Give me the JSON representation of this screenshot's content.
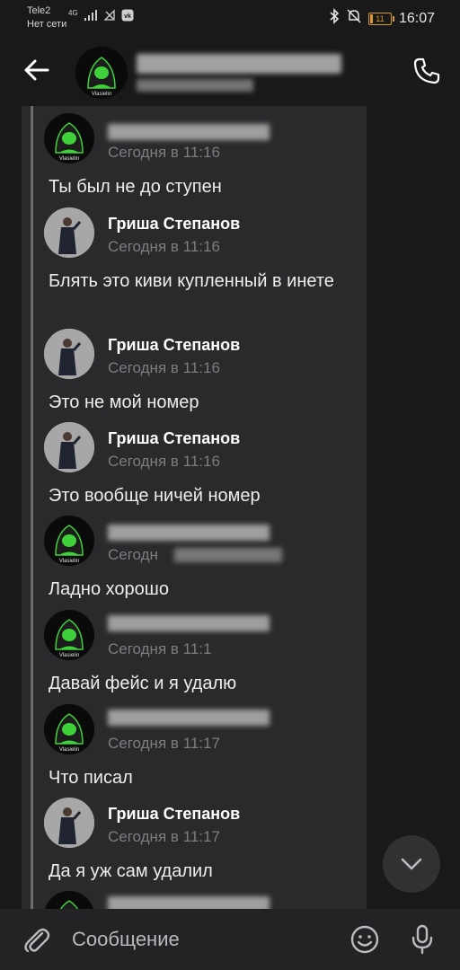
{
  "status_bar": {
    "carrier": "Tele2",
    "network": "Нет сети",
    "network_type": "4G",
    "battery": "11",
    "time": "16:07"
  },
  "header": {
    "back_icon": "arrow-left-icon",
    "call_icon": "phone-icon"
  },
  "messages": [
    {
      "author": "",
      "time": "Сегодня в 11:16",
      "text": "Ты был не до ступен",
      "avatar": "hacker"
    },
    {
      "author": "Гриша Степанов",
      "time": "Сегодня в 11:16",
      "text": "Блять это киви купленный в инете",
      "avatar": "person"
    },
    {
      "author": "Гриша Степанов",
      "time": "Сегодня в 11:16",
      "text": "Это не мой номер",
      "avatar": "person"
    },
    {
      "author": "Гриша Степанов",
      "time": "Сегодня в 11:16",
      "text": "Это вообще ничей номер",
      "avatar": "person"
    },
    {
      "author": "",
      "time": "Сегодн",
      "text": "Ладно хорошо",
      "avatar": "hacker"
    },
    {
      "author": "",
      "time": "Сегодня в 11:1",
      "text": "Давай фейс и я удалю",
      "avatar": "hacker"
    },
    {
      "author": "",
      "time": "Сегодня в 11:17",
      "text": "Что писал",
      "avatar": "hacker"
    },
    {
      "author": "Гриша Степанов",
      "time": "Сегодня в 11:17",
      "text": "Да я уж сам удалил",
      "avatar": "person"
    }
  ],
  "composer": {
    "placeholder": "Сообщение"
  },
  "colors": {
    "background": "#191919",
    "chat_panel": "#2a2a2c",
    "accent_green": "#3fd13a",
    "battery": "#d69a32"
  }
}
